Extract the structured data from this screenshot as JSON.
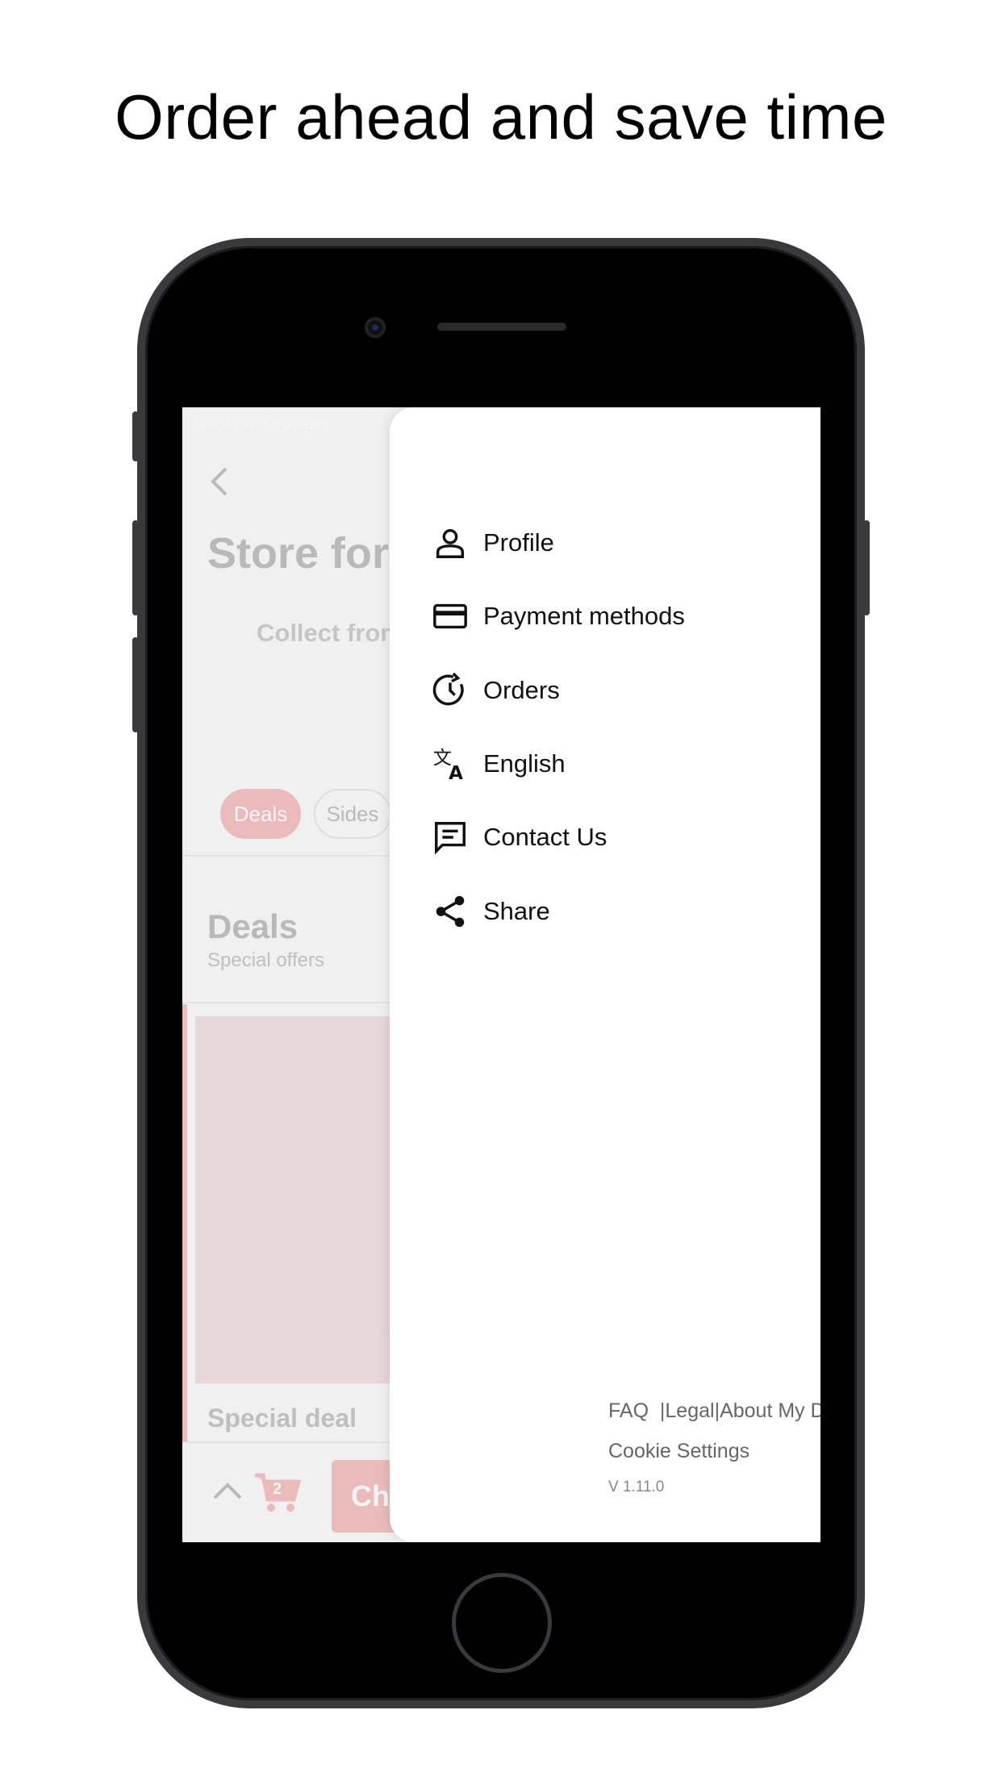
{
  "headline": "Order ahead and save time",
  "status_bar": {
    "carrier": "Network Provider"
  },
  "background": {
    "title": "Store for",
    "subtitle": "Collect from",
    "chips": [
      "Deals",
      "Sides"
    ],
    "section_title": "Deals",
    "section_subtitle": "Special offers",
    "card_title": "Special deal",
    "cart_count": "2",
    "checkout_label": "Ch",
    "accent_color": "#e35a5a"
  },
  "drawer": {
    "items": [
      {
        "label": "Profile",
        "icon": "person-icon"
      },
      {
        "label": "Payment methods",
        "icon": "credit-card-icon"
      },
      {
        "label": "Orders",
        "icon": "history-icon"
      },
      {
        "label": "English",
        "icon": "translate-icon"
      },
      {
        "label": "Contact Us",
        "icon": "chat-icon"
      },
      {
        "label": "Share",
        "icon": "share-icon"
      }
    ],
    "footer": {
      "faq": "FAQ",
      "legal": "Legal",
      "about": "About My Data",
      "cookie": "Cookie Settings",
      "version": "V 1.11.0"
    }
  }
}
